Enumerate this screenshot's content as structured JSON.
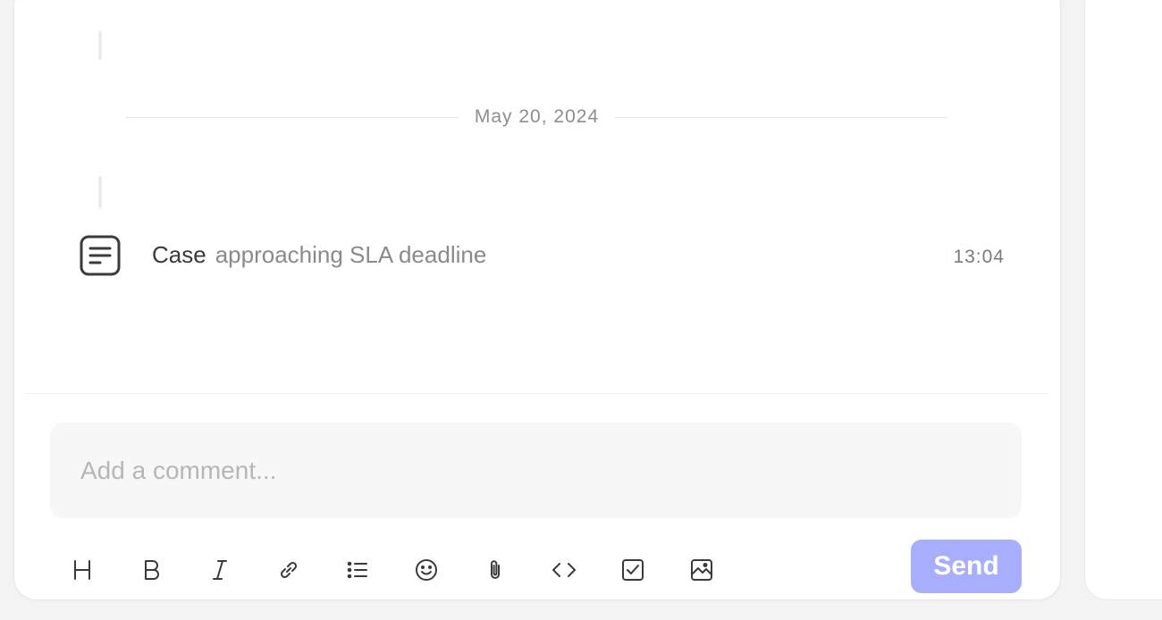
{
  "activity": {
    "date_divider": "May 20, 2024",
    "event": {
      "icon": "note-icon",
      "subject": "Case",
      "action": "approaching SLA deadline",
      "time": "13:04"
    }
  },
  "composer": {
    "placeholder": "Add a comment...",
    "value": "",
    "send_label": "Send",
    "send_color": "#a9aefc",
    "tools": [
      {
        "name": "heading-icon"
      },
      {
        "name": "bold-icon"
      },
      {
        "name": "italic-icon"
      },
      {
        "name": "link-icon"
      },
      {
        "name": "bullet-list-icon"
      },
      {
        "name": "emoji-icon"
      },
      {
        "name": "attachment-icon"
      },
      {
        "name": "code-icon"
      },
      {
        "name": "checkbox-icon"
      },
      {
        "name": "image-icon"
      }
    ]
  }
}
